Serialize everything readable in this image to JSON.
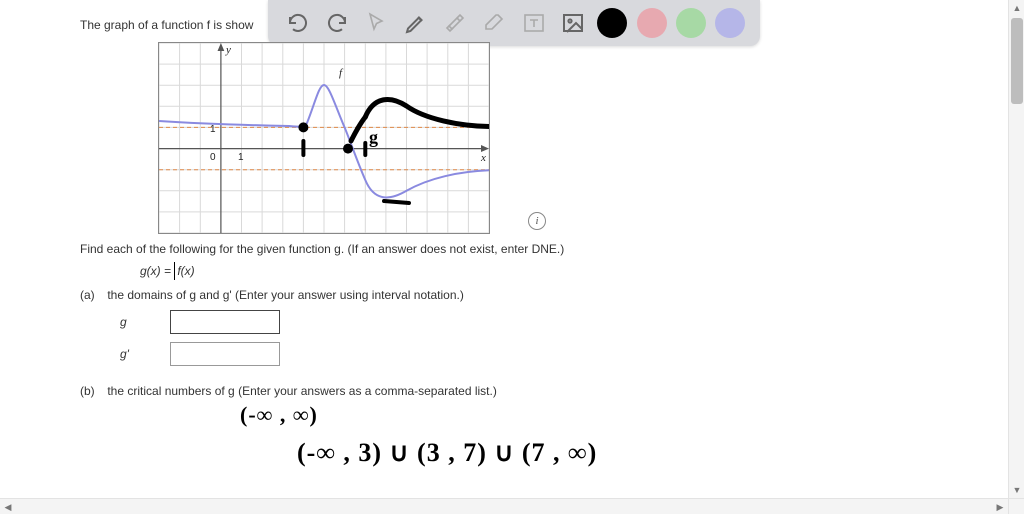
{
  "intro": "The graph of a function f is show",
  "graph": {
    "y_label": "y",
    "x_label": "x",
    "f_label": "f",
    "tick_zero": "0",
    "tick_one_y": "1",
    "tick_one_x": "1",
    "hand_g_label": "g"
  },
  "prompt": "Find each of the following for the given function g. (If an answer does not exist, enter DNE.)",
  "equation": {
    "lhs": "g(x) = ",
    "inner": "f(x)"
  },
  "parts": {
    "a": {
      "label": "(a)",
      "text": "the domains of g and g' (Enter your answer using interval notation.)",
      "row1_label": "g",
      "row2_label": "g'"
    },
    "b": {
      "label": "(b)",
      "text": "the critical numbers of g (Enter your answers as a comma-separated list.)"
    }
  },
  "handwriting": {
    "g_domain": "(-∞ , ∞)",
    "gprime_domain": "(-∞ , 3) ∪ (3 , 7) ∪ (7 , ∞)"
  },
  "chart_data": {
    "type": "line",
    "title": "",
    "xlabel": "x",
    "ylabel": "y",
    "xlim": [
      -3,
      13
    ],
    "ylim": [
      -4,
      5
    ],
    "grid": true,
    "asymptotes_h": [
      1,
      -1
    ],
    "series": [
      {
        "name": "f",
        "x": [
          -3,
          -2,
          -1,
          0,
          1,
          2,
          3,
          4,
          5,
          6,
          7,
          8,
          9,
          10,
          11,
          12,
          13
        ],
        "y": [
          1.3,
          1.25,
          1.2,
          1.15,
          1.1,
          1.08,
          1.05,
          1.0,
          3.0,
          1.0,
          -1.5,
          -2.5,
          -2.0,
          -1.4,
          -1.15,
          -1.07,
          -1.04
        ]
      }
    ],
    "annotations": [
      {
        "type": "hand-curve",
        "name": "g=|f|",
        "x": [
          7,
          8,
          9,
          10,
          11,
          12,
          13
        ],
        "y": [
          1.5,
          2.5,
          2.0,
          1.5,
          1.2,
          1.1,
          1.05
        ]
      },
      {
        "type": "point",
        "x": 4,
        "y": 1
      },
      {
        "type": "point",
        "x": 7,
        "y": 0
      }
    ]
  }
}
